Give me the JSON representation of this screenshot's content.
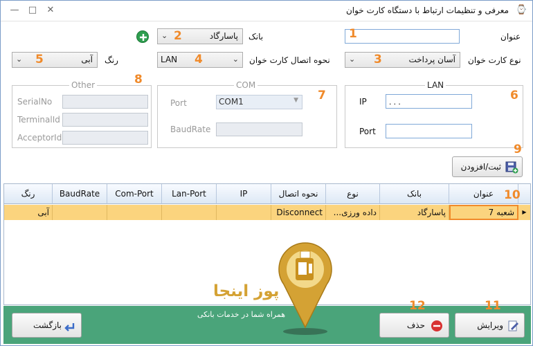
{
  "window": {
    "title": "معرفی و تنظیمات ارتباط با دستگاه کارت خوان"
  },
  "form": {
    "title_label": "عنوان",
    "title_value": "",
    "bank_label": "بانک",
    "bank_value": "پاسارگاد",
    "card_type_label": "نوع کارت خوان",
    "card_type_value": "آسان پرداخت",
    "connection_label": "نحوه اتصال کارت خوان",
    "connection_value": "LAN",
    "color_label": "رنگ",
    "color_value": "آبی"
  },
  "groups": {
    "lan": {
      "title": "LAN",
      "ip_label": "IP",
      "ip_value": ". . .",
      "port_label": "Port",
      "port_value": ""
    },
    "com": {
      "title": "COM",
      "port_label": "Port",
      "port_value": "COM1",
      "baud_label": "BaudRate"
    },
    "other": {
      "title": "Other",
      "serial_label": "SerialNo",
      "terminal_label": "TerminalId",
      "acceptor_label": "AcceptorId"
    }
  },
  "buttons": {
    "save": "ثبت/افزودن",
    "edit": "ویرایش",
    "delete": "حذف",
    "back": "بازگشت"
  },
  "table": {
    "columns": [
      "عنوان",
      "بانک",
      "نوع",
      "نحوه اتصال",
      "IP",
      "Lan-Port",
      "Com-Port",
      "BaudRate",
      "رنگ"
    ],
    "rows": [
      [
        "شعبه 7",
        "پاسارگاد",
        "داده ورزی...",
        "Disconnect",
        "",
        "",
        "",
        "",
        "آبی"
      ]
    ]
  },
  "watermark": {
    "brand": "پوز اینجا",
    "tagline": "همراه شما در خدمات بانکی"
  },
  "annotations": [
    "1",
    "2",
    "3",
    "4",
    "5",
    "6",
    "7",
    "8",
    "9",
    "10",
    "11",
    "12"
  ],
  "colors": {
    "accent_orange": "#f08a2a",
    "footer_green": "#4aa47a",
    "selected_row": "#fbd47e",
    "logo_gold": "#d4a234"
  }
}
